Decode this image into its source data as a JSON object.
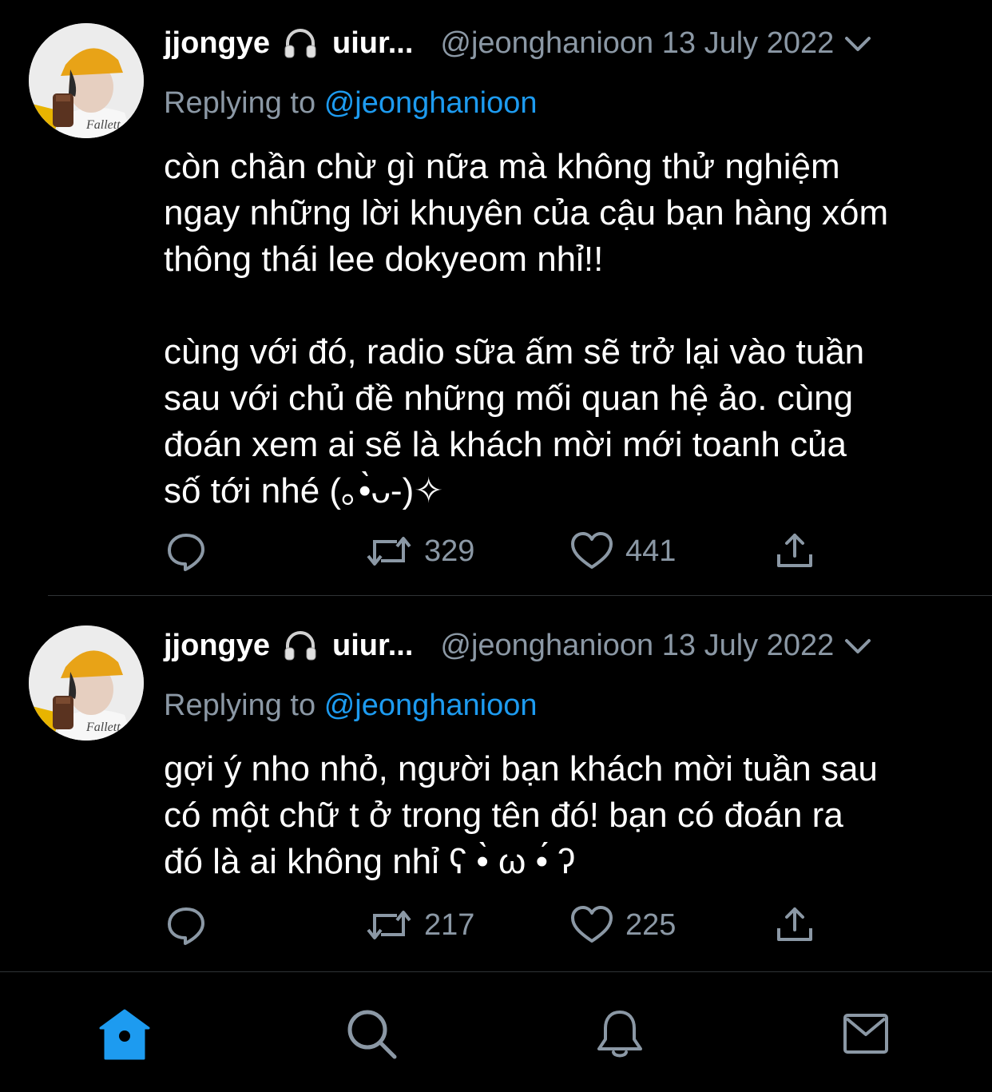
{
  "colors": {
    "background": "#000000",
    "text": "#ffffff",
    "secondary_text": "#8b98a5",
    "accent": "#1d9bf0",
    "divider": "#2f3336"
  },
  "tweets": [
    {
      "display_name": "jjongye",
      "name_icon": "headphones-icon",
      "display_name_suffix": "uiur...",
      "handle_date": "@jeonghanioon 13 July 2022",
      "replying_label": "Replying to",
      "replying_handle": "@jeonghanioon",
      "text": "còn chần chừ gì nữa mà không thử nghiệm\nngay những lời khuyên của cậu bạn hàng xóm\nthông thái lee dokyeom nhỉ!!\n\ncùng với đó, radio sữa ấm sẽ trở lại vào tuần\nsau với chủ đề những mối quan hệ ảo. cùng\nđoán xem ai sẽ là khách mời mới toanh của\nsố tới nhé (｡•̀ᴗ-)✧",
      "retweets": "329",
      "likes": "441"
    },
    {
      "display_name": "jjongye",
      "name_icon": "headphones-icon",
      "display_name_suffix": "uiur...",
      "handle_date": "@jeonghanioon 13 July 2022",
      "replying_label": "Replying to",
      "replying_handle": "@jeonghanioon",
      "text": "gợi ý nho nhỏ, người bạn khách mời tuần sau\ncó một chữ t ở trong tên đó! bạn có đoán ra\nđó là ai không nhỉ ʕ •̀ ω •́ ʔ",
      "retweets": "217",
      "likes": "225"
    }
  ],
  "tabbar": {
    "active": "home",
    "icons": [
      "home-icon",
      "search-icon",
      "bell-icon",
      "mail-icon"
    ]
  }
}
